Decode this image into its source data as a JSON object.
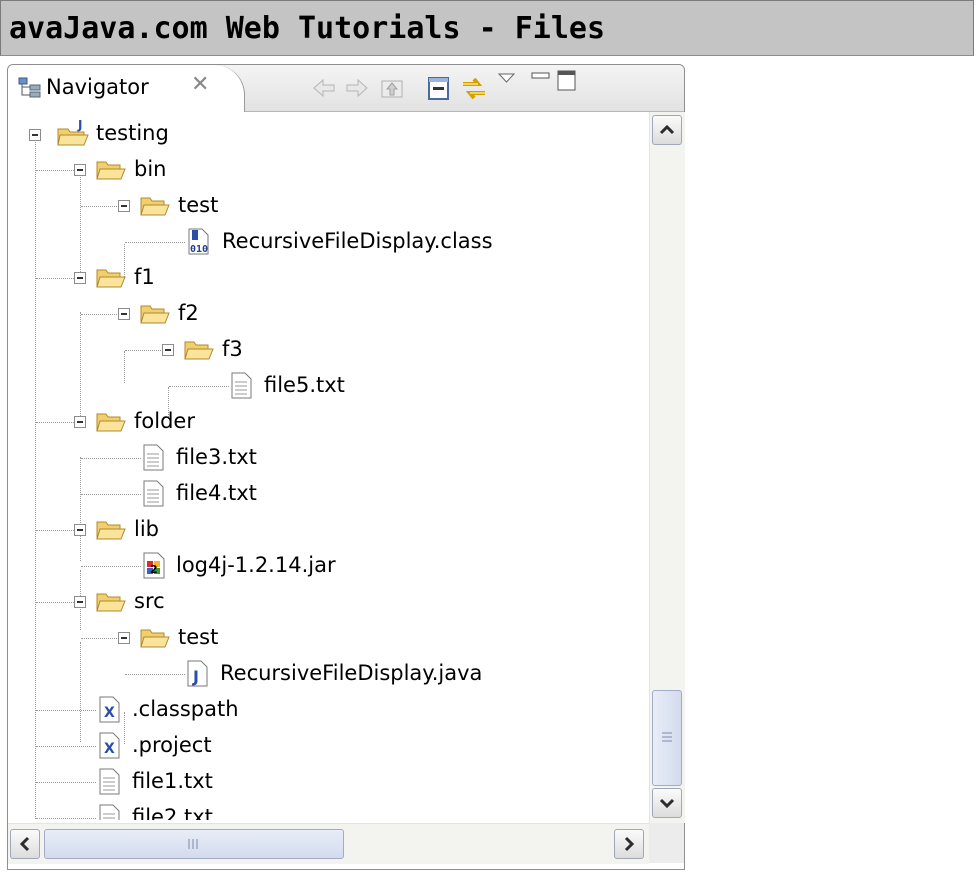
{
  "window": {
    "title": "avaJava.com Web Tutorials - Files"
  },
  "view": {
    "tab_label": "Navigator",
    "tab_close_glyph": "✕",
    "toolbar": [
      "back-icon",
      "forward-icon",
      "up-icon",
      "collapse-all-icon",
      "link-with-editor-icon",
      "view-menu-icon",
      "minimize-icon",
      "maximize-icon"
    ]
  },
  "tree": {
    "root": "testing",
    "bin": "bin",
    "bin_test": "test",
    "class_file": "RecursiveFileDisplay.class",
    "f1": "f1",
    "f2": "f2",
    "f3": "f3",
    "file5": "file5.txt",
    "folder": "folder",
    "file3": "file3.txt",
    "file4": "file4.txt",
    "lib": "lib",
    "jar": "log4j-1.2.14.jar",
    "src": "src",
    "src_test": "test",
    "java_file": "RecursiveFileDisplay.java",
    "classpath": ".classpath",
    "project": ".project",
    "file1": "file1.txt",
    "file2": "file2.txt"
  },
  "colors": {
    "title_bar": "#c4c4c4",
    "folder": "#f2cf6e",
    "java_icon": "#2b4fa8"
  }
}
